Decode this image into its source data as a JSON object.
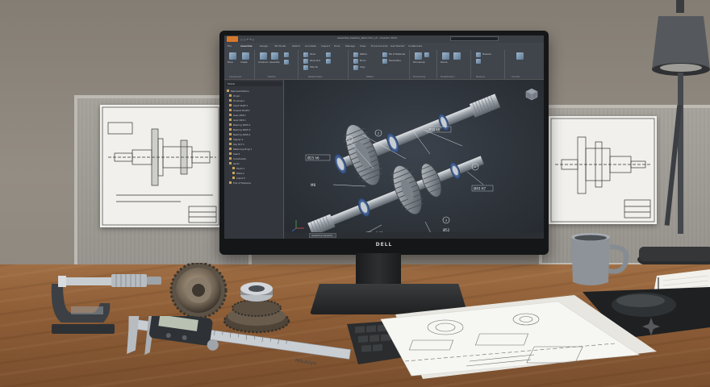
{
  "monitor": {
    "brand_logo": "DELL"
  },
  "cad_app": {
    "window_title": "Assembly Gearbox_Reduction_v3 - Inventor 2024",
    "search_placeholder": "Search Help & Commands...",
    "ribbon_tabs": [
      "File",
      "Assemble",
      "Design",
      "3D Model",
      "Sketch",
      "Annotate",
      "Inspect",
      "Tools",
      "Manage",
      "View",
      "Environments",
      "Get Started",
      "Collaborate"
    ],
    "ribbon_groups": [
      {
        "title": "Component",
        "items": [
          "Place",
          "Create",
          "Place from Content Center"
        ]
      },
      {
        "title": "Position",
        "items": [
          "Constrain",
          "Assemble",
          "Joint"
        ]
      },
      {
        "title": "Relationships",
        "items": [
          "Show",
          "Show Sick",
          "Hide All"
        ]
      },
      {
        "title": "Pattern",
        "items": [
          "Pattern",
          "Mirror",
          "Copy"
        ]
      },
      {
        "title": "Manage",
        "items": [
          "Bill of Materials",
          "Parameters"
        ]
      },
      {
        "title": "Productivity",
        "items": [
          "Shrinkwrap",
          "Simplify"
        ]
      },
      {
        "title": "Simplification",
        "items": [
          "Derive",
          "Substitute"
        ]
      },
      {
        "title": "Measure",
        "items": [
          "Measure"
        ]
      },
      {
        "title": "Convert",
        "items": [
          "Convert"
        ]
      }
    ],
    "browser": {
      "header": "Model",
      "items": [
        "Representations",
        "Origin",
        "Housing:1",
        "Input Shaft:1",
        "Output Shaft:1",
        "Gear Z28:1",
        "Gear Z42:1",
        "Bearing 6205:1",
        "Bearing 6205:2",
        "Bearing 6206:1",
        "Spacer:1",
        "Key 8x7:1",
        "Retaining Ring:1",
        "Seal:1",
        "Constraints",
        "Joints",
        "Flush:1",
        "Mate:2",
        "Insert:3",
        "End of Features"
      ]
    },
    "viewport_tab": "Assembly Gearbox",
    "callout_numbers": [
      "1",
      "2",
      "3",
      "4",
      "5",
      "6"
    ],
    "dimensions": [
      "Ø25 h6",
      "Ø30 k6",
      "Ø40 H7",
      "M8",
      "Ø35 ±0.02",
      "Ø52"
    ]
  },
  "desk_items": {
    "caliper_brand": "Mitutoyo",
    "caliper_reading": "",
    "micrometer_brand": ""
  },
  "colors": {
    "app_button": "#d6782c",
    "viewport": "#2c3138",
    "desk": "#8d5d36",
    "wall": "#8a847b"
  }
}
